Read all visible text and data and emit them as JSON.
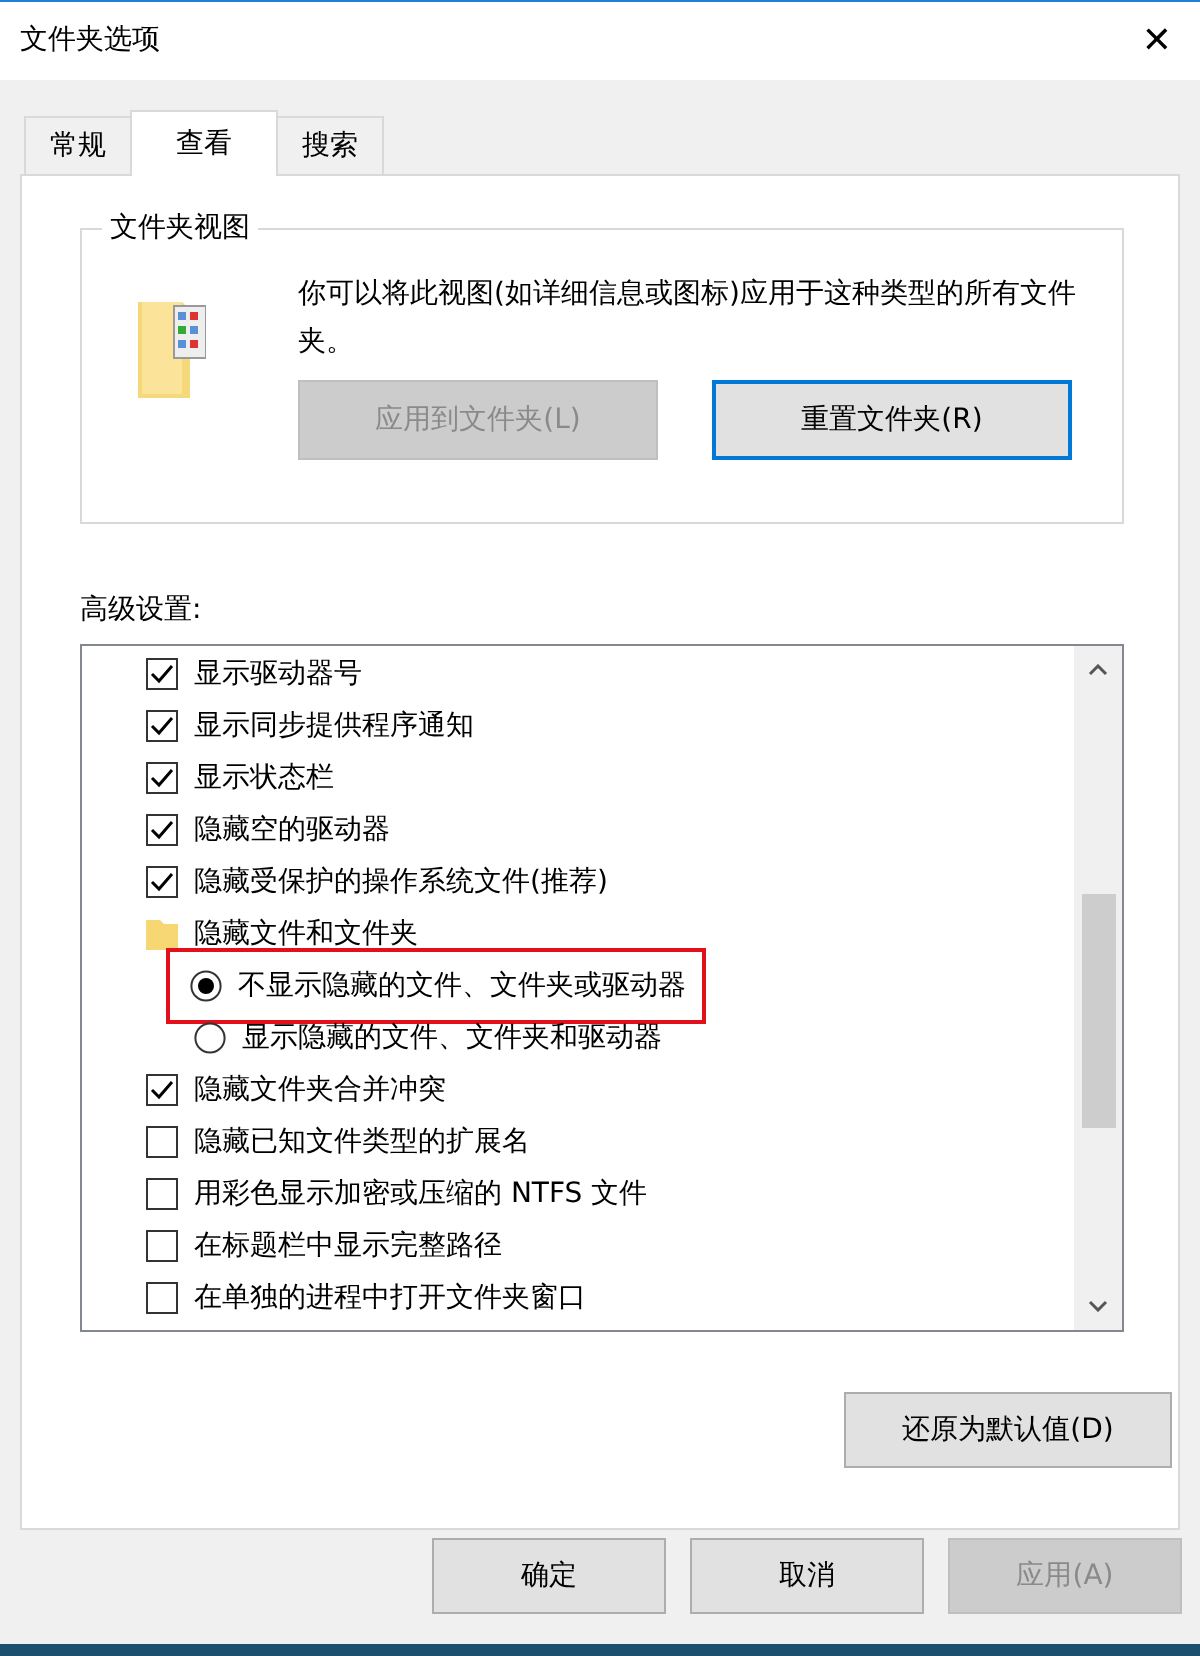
{
  "window": {
    "title": "文件夹选项",
    "close": "✕"
  },
  "tabs": [
    {
      "label": "常规",
      "selected": false
    },
    {
      "label": "查看",
      "selected": true
    },
    {
      "label": "搜索",
      "selected": false
    }
  ],
  "folder_views": {
    "title": "文件夹视图",
    "description": "你可以将此视图(如详细信息或图标)应用于这种类型的所有文件夹。",
    "buttons": [
      {
        "label": "应用到文件夹(L)",
        "disabled": true,
        "focused": false
      },
      {
        "label": "重置文件夹(R)",
        "disabled": false,
        "focused": true
      }
    ]
  },
  "advanced": {
    "label": "高级设置:",
    "items": [
      {
        "kind": "checkbox",
        "label": "显示驱动器号",
        "checked": true
      },
      {
        "kind": "checkbox",
        "label": "显示同步提供程序通知",
        "checked": true
      },
      {
        "kind": "checkbox",
        "label": "显示状态栏",
        "checked": true
      },
      {
        "kind": "checkbox",
        "label": "隐藏空的驱动器",
        "checked": true
      },
      {
        "kind": "checkbox",
        "label": "隐藏受保护的操作系统文件(推荐)",
        "checked": true
      },
      {
        "kind": "folder",
        "label": "隐藏文件和文件夹",
        "children": [
          {
            "kind": "radio",
            "label": "不显示隐藏的文件、文件夹或驱动器",
            "checked": true,
            "highlighted": true
          },
          {
            "kind": "radio",
            "label": "显示隐藏的文件、文件夹和驱动器",
            "checked": false,
            "highlighted": false
          }
        ]
      },
      {
        "kind": "checkbox",
        "label": "隐藏文件夹合并冲突",
        "checked": true
      },
      {
        "kind": "checkbox",
        "label": "隐藏已知文件类型的扩展名",
        "checked": false
      },
      {
        "kind": "checkbox",
        "label": "用彩色显示加密或压缩的 NTFS 文件",
        "checked": false
      },
      {
        "kind": "checkbox",
        "label": "在标题栏中显示完整路径",
        "checked": false
      },
      {
        "kind": "checkbox",
        "label": "在单独的进程中打开文件夹窗口",
        "checked": false
      }
    ],
    "restore_button": "还原为默认值(D)"
  },
  "footer_buttons": [
    {
      "label": "确定",
      "disabled": false
    },
    {
      "label": "取消",
      "disabled": false
    },
    {
      "label": "应用(A)",
      "disabled": true
    }
  ]
}
